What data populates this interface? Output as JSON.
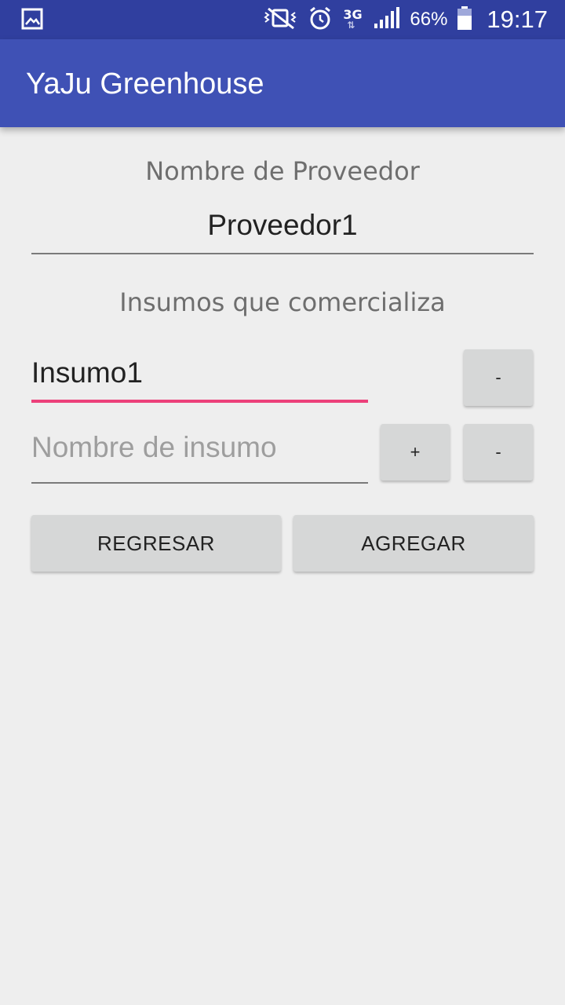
{
  "status_bar": {
    "battery_percent": "66%",
    "time": "19:17",
    "network": "3G",
    "icons": [
      "image-icon",
      "mute-vibrate-icon",
      "alarm-icon",
      "network-3g-icon",
      "signal-icon",
      "battery-icon"
    ]
  },
  "app_bar": {
    "title": "YaJu Greenhouse",
    "color": "#3f51b5",
    "status_color": "#303f9f"
  },
  "form": {
    "provider_label": "Nombre de Proveedor",
    "provider_value": "Proveedor1",
    "supplies_label": "Insumos que comercializa",
    "supply_rows": [
      {
        "value": "Insumo1",
        "focused": true,
        "buttons": [
          "-"
        ]
      },
      {
        "value": "",
        "placeholder": "Nombre de insumo",
        "buttons": [
          "+",
          "-"
        ]
      }
    ],
    "back_button": "REGRESAR",
    "add_button": "AGREGAR",
    "accent_color": "#ec407a"
  }
}
